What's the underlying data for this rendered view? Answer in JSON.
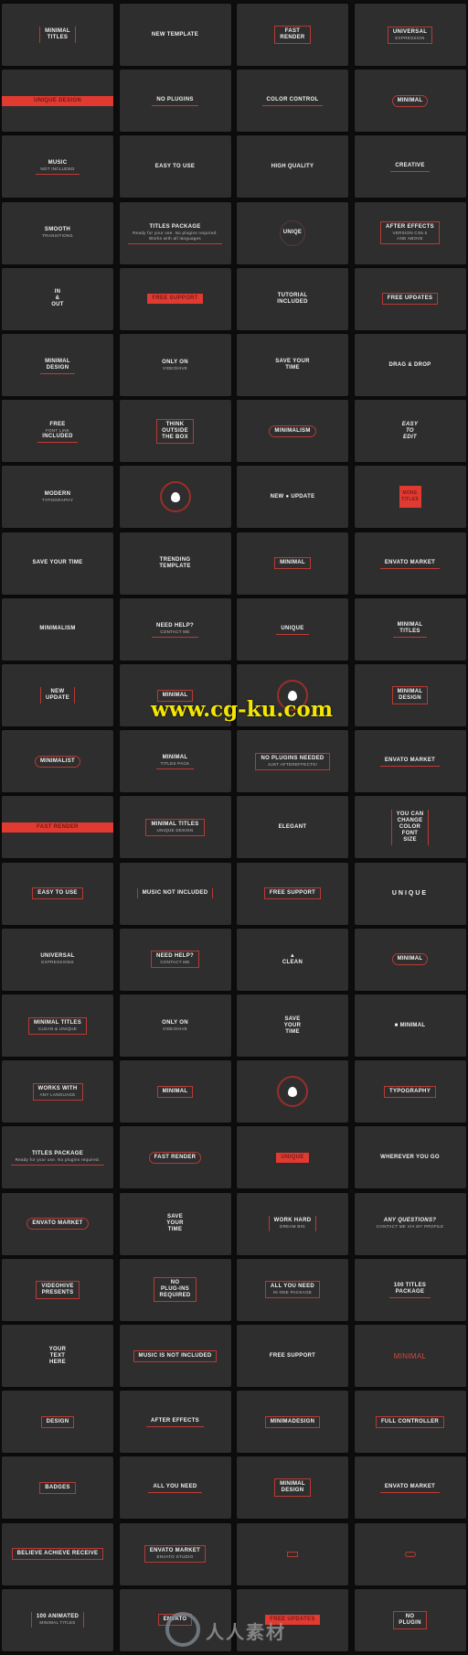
{
  "colors": {
    "accent": "#e03a31",
    "tile": "#2e2e2f",
    "background": "#0e0e0e"
  },
  "watermarks": {
    "site": "www.cg-ku.com",
    "brand": "人人素材"
  },
  "tiles": [
    [
      {
        "lines": [
          "MINIMAL",
          "TITLES"
        ],
        "style": "vbar"
      },
      {
        "lines": [
          "NEW TEMPLATE"
        ],
        "style": "plain"
      },
      {
        "lines": [
          "FAST",
          "RENDER"
        ],
        "style": "box"
      },
      {
        "lines": [
          "UNIVERSAL",
          "EXPRESSION"
        ],
        "style": "box"
      }
    ],
    [
      {
        "lines": [
          "UNIQUE DESIGN"
        ],
        "style": "fullbar"
      },
      {
        "lines": [
          "NO PLUGINS"
        ],
        "style": "underline"
      },
      {
        "lines": [
          "COLOR CONTROL"
        ],
        "style": "underline"
      },
      {
        "lines": [
          "MINIMAL"
        ],
        "style": "hex"
      }
    ],
    [
      {
        "lines": [
          "MUSIC",
          "NOT INCLUDED"
        ],
        "style": "underline"
      },
      {
        "lines": [
          "EASY TO USE"
        ],
        "style": "plain"
      },
      {
        "lines": [
          "HIGH QUALITY"
        ],
        "style": "plain"
      },
      {
        "lines": [
          "CREATIVE"
        ],
        "style": "underline"
      }
    ],
    [
      {
        "lines": [
          "SMOOTH",
          "TRANSITIONS"
        ],
        "style": "plain"
      },
      {
        "lines": [
          "TITLES PACKAGE",
          "Ready for your use. No plugins required.",
          "Works with all languages"
        ],
        "style": "underline"
      },
      {
        "lines": [
          "UNIQE"
        ],
        "style": "circle"
      },
      {
        "lines": [
          "AFTER EFFECTS",
          "VERSION CS5.5",
          "AND ABOVE"
        ],
        "style": "box"
      }
    ],
    [
      {
        "lines": [
          "IN",
          "&",
          "OUT"
        ],
        "style": "plain"
      },
      {
        "lines": [
          "FREE SUPPORT"
        ],
        "style": "redfill"
      },
      {
        "lines": [
          "TUTORIAL",
          "INCLUDED"
        ],
        "style": "plain"
      },
      {
        "lines": [
          "FREE UPDATES"
        ],
        "style": "box"
      }
    ],
    [
      {
        "lines": [
          "MINIMAL",
          "DESIGN"
        ],
        "style": "underline"
      },
      {
        "lines": [
          "ONLY ON",
          "VIDEOHIVE"
        ],
        "style": "plain"
      },
      {
        "lines": [
          "SAVE YOUR",
          "TIME"
        ],
        "style": "plain"
      },
      {
        "lines": [
          "DRAG & DROP"
        ],
        "style": "plain"
      }
    ],
    [
      {
        "lines": [
          "FREE",
          "FONT LINK",
          "INCLUDED"
        ],
        "style": "underline"
      },
      {
        "lines": [
          "THINK",
          "OUTSIDE",
          "THE BOX"
        ],
        "style": "box"
      },
      {
        "lines": [
          "MINIMALISM"
        ],
        "style": "hex"
      },
      {
        "lines": [
          "EASY",
          "TO",
          "EDIT"
        ],
        "style": "italic"
      }
    ],
    [
      {
        "lines": [
          "MODERN",
          "TYPOGRAPHY"
        ],
        "style": "plain"
      },
      {
        "lines": [],
        "style": "logo"
      },
      {
        "lines": [
          "NEW ● UPDATE"
        ],
        "style": "plain"
      },
      {
        "lines": [
          "MORE",
          "TITLES"
        ],
        "style": "redsq"
      }
    ],
    [
      {
        "lines": [
          "SAVE  YOUR  TIME"
        ],
        "style": "plain"
      },
      {
        "lines": [
          "TRENDING",
          "TEMPLATE"
        ],
        "style": "plain"
      },
      {
        "lines": [
          "MINIMAL"
        ],
        "style": "box"
      },
      {
        "lines": [
          "ENVATO MARKET"
        ],
        "style": "underline"
      }
    ],
    [
      {
        "lines": [
          "MINIMALISM"
        ],
        "style": "plain"
      },
      {
        "lines": [
          "NEED HELP?",
          "CONTACT ME"
        ],
        "style": "underline"
      },
      {
        "lines": [
          "UNIQUE"
        ],
        "style": "underline"
      },
      {
        "lines": [
          "MINIMAL",
          "TITLES"
        ],
        "style": "underline"
      }
    ],
    [
      {
        "lines": [
          "NEW",
          "UPDATE"
        ],
        "style": "vbar"
      },
      {
        "lines": [
          "MINIMAL"
        ],
        "style": "box"
      },
      {
        "lines": [],
        "style": "logo"
      },
      {
        "lines": [
          "MINIMAL",
          "DESIGN"
        ],
        "style": "box"
      }
    ],
    [
      {
        "lines": [
          "MINIMALIST"
        ],
        "style": "hex"
      },
      {
        "lines": [
          "MINIMAL",
          "TITLES PACK"
        ],
        "style": "underline"
      },
      {
        "lines": [
          "NO PLUGINS NEEDED",
          "JUST AFTEREFFECTS!"
        ],
        "style": "box"
      },
      {
        "lines": [
          "ENVATO MARKET"
        ],
        "style": "underline"
      }
    ],
    [
      {
        "lines": [
          "FAST RENDER"
        ],
        "style": "fullbar"
      },
      {
        "lines": [
          "MINIMAL TITLES",
          "UNIQUE DESIGN"
        ],
        "style": "box"
      },
      {
        "lines": [
          "ELEGANT"
        ],
        "style": "plain"
      },
      {
        "lines": [
          "YOU CAN",
          "CHANGE",
          "COLOR",
          "FONT",
          "SIZE"
        ],
        "style": "vbar"
      }
    ],
    [
      {
        "lines": [
          "EASY TO USE"
        ],
        "style": "box"
      },
      {
        "lines": [
          "MUSIC NOT INCLUDED"
        ],
        "style": "vbar"
      },
      {
        "lines": [
          "FREE SUPPORT"
        ],
        "style": "box"
      },
      {
        "lines": [
          "UNIQUE"
        ],
        "style": "spaced"
      }
    ],
    [
      {
        "lines": [
          "UNIVERSAL",
          "EXPRESSIONS"
        ],
        "style": "plain"
      },
      {
        "lines": [
          "NEED HELP?",
          "CONTACT ME"
        ],
        "style": "box"
      },
      {
        "lines": [
          "▲",
          "CLEAN"
        ],
        "style": "plain"
      },
      {
        "lines": [
          "MINIMAL"
        ],
        "style": "hex"
      }
    ],
    [
      {
        "lines": [
          "MINIMAL TITLES",
          "CLEAN & UNIQUE"
        ],
        "style": "box"
      },
      {
        "lines": [
          "ONLY ON",
          "VIDEOHIVE"
        ],
        "style": "plain"
      },
      {
        "lines": [
          "SAVE",
          "YOUR",
          "TIME"
        ],
        "style": "plain"
      },
      {
        "lines": [
          "■ MINIMAL"
        ],
        "style": "plain"
      }
    ],
    [
      {
        "lines": [
          "WORKS WITH",
          "ANY LANGUAGE"
        ],
        "style": "box"
      },
      {
        "lines": [
          "MINIMAL"
        ],
        "style": "box"
      },
      {
        "lines": [],
        "style": "logo"
      },
      {
        "lines": [
          "TYPOGRAPHY"
        ],
        "style": "box"
      }
    ],
    [
      {
        "lines": [
          "TITLES PACKAGE",
          "Ready for your use. No plugins required."
        ],
        "style": "underline"
      },
      {
        "lines": [
          "FAST RENDER"
        ],
        "style": "hex"
      },
      {
        "lines": [
          "UNIQUE"
        ],
        "style": "redfill"
      },
      {
        "lines": [
          "WHEREVER YOU  GO"
        ],
        "style": "plain"
      }
    ],
    [
      {
        "lines": [
          "ENVATO MARKET"
        ],
        "style": "hex"
      },
      {
        "lines": [
          "SAVE",
          "YOUR",
          "TIME"
        ],
        "style": "plain"
      },
      {
        "lines": [
          "WORK HARD",
          "DREAM BIG"
        ],
        "style": "vbar"
      },
      {
        "lines": [
          "ANY QUESTIONS?",
          "CONTACT ME VIA MY PROFILE"
        ],
        "style": "italic"
      }
    ],
    [
      {
        "lines": [
          "VIDEOHIVE",
          "PRESENTS"
        ],
        "style": "box"
      },
      {
        "lines": [
          "NO",
          "PLUG-INS",
          "REQUIRED"
        ],
        "style": "box"
      },
      {
        "lines": [
          "ALL YOU NEED",
          "IN ONE PACKAGE"
        ],
        "style": "box"
      },
      {
        "lines": [
          "100 TITLES",
          "PACKAGE"
        ],
        "style": "underline"
      }
    ],
    [
      {
        "lines": [
          "YOUR",
          "TEXT",
          "HERE"
        ],
        "style": "plain"
      },
      {
        "lines": [
          "MUSIC IS NOT INCLUDED"
        ],
        "style": "box"
      },
      {
        "lines": [
          "FREE SUPPORT"
        ],
        "style": "plain"
      },
      {
        "lines": [
          "MINIMAL"
        ],
        "style": "red"
      }
    ],
    [
      {
        "lines": [
          "DESIGN"
        ],
        "style": "box"
      },
      {
        "lines": [
          "AFTER EFFECTS"
        ],
        "style": "underline"
      },
      {
        "lines": [
          "MINIMADESIGN"
        ],
        "style": "box"
      },
      {
        "lines": [
          "FULL CONTROLLER"
        ],
        "style": "box"
      }
    ],
    [
      {
        "lines": [
          "BADGES"
        ],
        "style": "box"
      },
      {
        "lines": [
          "ALL YOU NEED"
        ],
        "style": "underline"
      },
      {
        "lines": [
          "MINIMAL",
          "DESIGN"
        ],
        "style": "box"
      },
      {
        "lines": [
          "ENVATO MARKET"
        ],
        "style": "underline"
      }
    ],
    [
      {
        "lines": [
          "BELIEVE  ACHIEVE RECEIVE"
        ],
        "style": "box"
      },
      {
        "lines": [
          "ENVATO MARKET",
          "ENVATO STUDIO"
        ],
        "style": "box"
      },
      {
        "lines": [],
        "style": "box"
      },
      {
        "lines": [],
        "style": "hex"
      }
    ],
    [
      {
        "lines": [
          "100 ANIMATED",
          "MINIMAL TITLES"
        ],
        "style": "vbar"
      },
      {
        "lines": [
          "ENVATO"
        ],
        "style": "box"
      },
      {
        "lines": [
          "FREE UPDATES"
        ],
        "style": "redfill"
      },
      {
        "lines": [
          "NO",
          "PLUGIN"
        ],
        "style": "box"
      }
    ]
  ]
}
